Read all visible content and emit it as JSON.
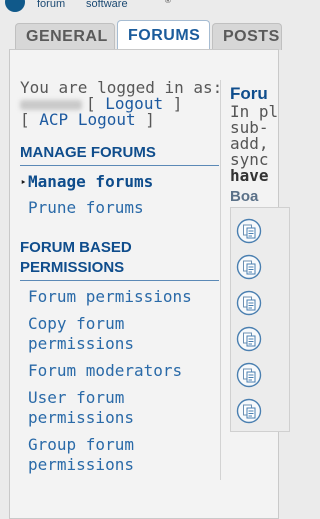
{
  "logo": {
    "line1": "forum",
    "line2": "software",
    "mark": "®"
  },
  "tabs": [
    {
      "label": "GENERAL",
      "active": false
    },
    {
      "label": "FORUMS",
      "active": true
    },
    {
      "label": "POSTS",
      "active": false
    }
  ],
  "session": {
    "logged_in_label": "You are logged in as:",
    "logout_label": "Logout",
    "acp_logout_label": "ACP Logout"
  },
  "sidebar": {
    "manage_forums_header": "MANAGE FORUMS",
    "manage_items": [
      {
        "label": "Manage forums",
        "active": true
      },
      {
        "label": "Prune forums",
        "active": false
      }
    ],
    "permissions_header_line1": "FORUM BASED",
    "permissions_header_line2": "PERMISSIONS",
    "permission_items": [
      {
        "line1": "Forum permissions",
        "line2": ""
      },
      {
        "line1": "Copy forum",
        "line2": "permissions"
      },
      {
        "line1": "Forum moderators",
        "line2": ""
      },
      {
        "line1": "User forum",
        "line2": "permissions"
      },
      {
        "line1": "Group forum",
        "line2": "permissions"
      }
    ]
  },
  "main": {
    "title": "Foru",
    "text_lines": [
      "In pl",
      "sub-",
      "add,",
      "sync"
    ],
    "bold_text": "have",
    "board_header": "Boa",
    "forum_icon_count": 6
  },
  "colors": {
    "accent": "#0f4d8c",
    "link": "#2a6aa8",
    "tab_active_bg": "#ffffff",
    "tab_inactive_bg": "#d7d7d7"
  }
}
